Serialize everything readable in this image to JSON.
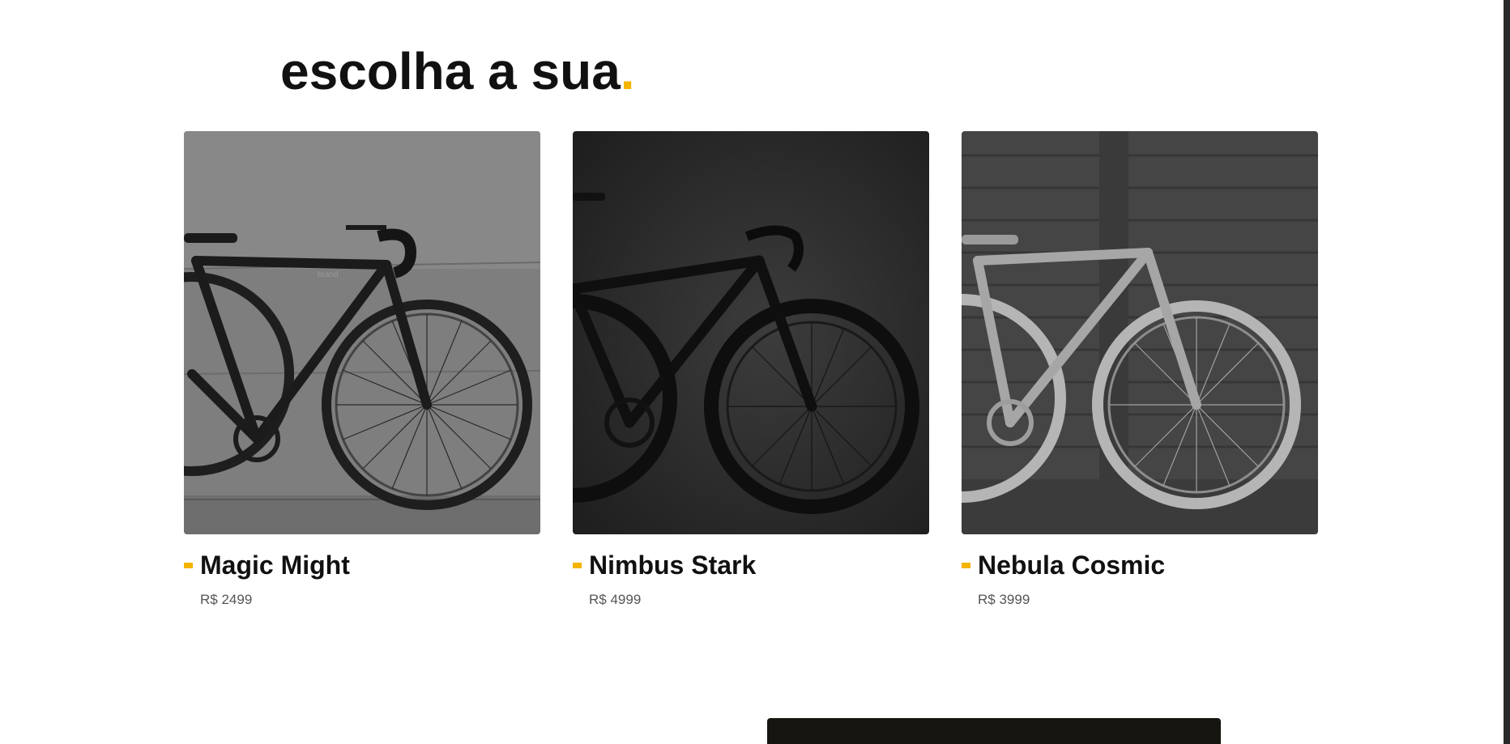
{
  "section": {
    "heading": "escolha a sua",
    "heading_dot": ".",
    "accent_color": "#f5b400"
  },
  "products": [
    {
      "name": "Magic Might",
      "price": "R$ 2499",
      "image_icon": "bicycle-photo",
      "tone": "gray"
    },
    {
      "name": "Nimbus Stark",
      "price": "R$ 4999",
      "image_icon": "bicycle-photo",
      "tone": "dark"
    },
    {
      "name": "Nebula Cosmic",
      "price": "R$ 3999",
      "image_icon": "bicycle-photo",
      "tone": "light"
    }
  ]
}
